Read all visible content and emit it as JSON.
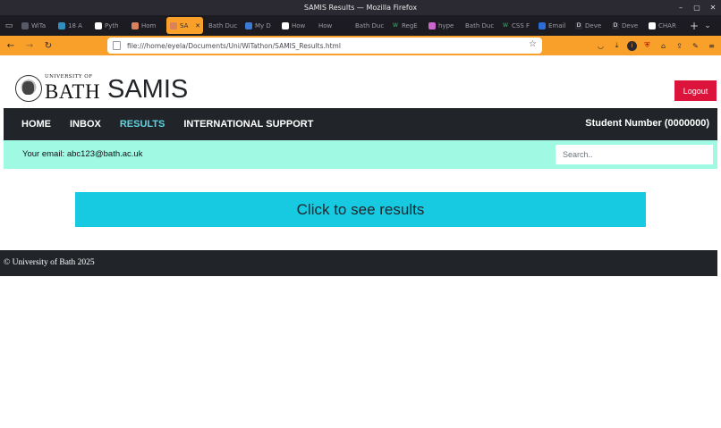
{
  "window": {
    "title": "SAMIS Results — Mozilla Firefox"
  },
  "tabs": [
    {
      "label": "WiTa",
      "fav_color": "#555a66",
      "fav_glyph": ""
    },
    {
      "label": "18 A",
      "fav_color": "#2f8fbf",
      "fav_glyph": ""
    },
    {
      "label": "Pyth",
      "fav_color": "#ffffff",
      "fav_glyph": ""
    },
    {
      "label": "Hom",
      "fav_color": "#d9825b",
      "fav_glyph": ""
    },
    {
      "label": "SA",
      "fav_color": "#d9825b",
      "fav_glyph": "",
      "active": true
    },
    {
      "label": "Bath Duc",
      "fav_color": "",
      "fav_glyph": ""
    },
    {
      "label": "My D",
      "fav_color": "#3a7bd5",
      "fav_glyph": ""
    },
    {
      "label": "How",
      "fav_color": "#ffffff",
      "fav_glyph": ""
    },
    {
      "label": "How",
      "fav_color": "",
      "fav_glyph": ""
    },
    {
      "label": "Bath Duc",
      "fav_color": "",
      "fav_glyph": ""
    },
    {
      "label": "RegE",
      "fav_color": "",
      "fav_glyph": "W"
    },
    {
      "label": "hype",
      "fav_color": "#cc66cc",
      "fav_glyph": ""
    },
    {
      "label": "Bath Duc",
      "fav_color": "",
      "fav_glyph": ""
    },
    {
      "label": "CSS F",
      "fav_color": "",
      "fav_glyph": "W"
    },
    {
      "label": "Email",
      "fav_color": "#2b6cd6",
      "fav_glyph": ""
    },
    {
      "label": "Deve",
      "fav_color": "#2b2a33",
      "fav_glyph": "D"
    },
    {
      "label": "Deve",
      "fav_color": "#2b2a33",
      "fav_glyph": "D"
    },
    {
      "label": "CHAR",
      "fav_color": "#ffffff",
      "fav_glyph": ""
    }
  ],
  "url": "file:///home/eyela/Documents/Uni/WiTathon/SAMIS_Results.html",
  "header": {
    "logo_small": "UNIVERSITY OF",
    "logo_big": "BATH",
    "site_title": "SAMIS",
    "logout_label": "Logout"
  },
  "nav": {
    "links": [
      "HOME",
      "INBOX",
      "RESULTS",
      "INTERNATIONAL SUPPORT"
    ],
    "active": "RESULTS",
    "student_number": "Student Number (0000000)"
  },
  "info": {
    "email_text": "Your email: abc123@bath.ac.uk",
    "search_placeholder": "Search.."
  },
  "results_button_label": "Click to see results",
  "footer_text": "© University of Bath 2025",
  "colors": {
    "browser_accent": "#f9a02b",
    "nav_bg": "#212529",
    "nav_active": "#60d2e0",
    "info_bg": "#9ff9e3",
    "results_button": "#17c9e1",
    "logout": "#dc143c"
  }
}
